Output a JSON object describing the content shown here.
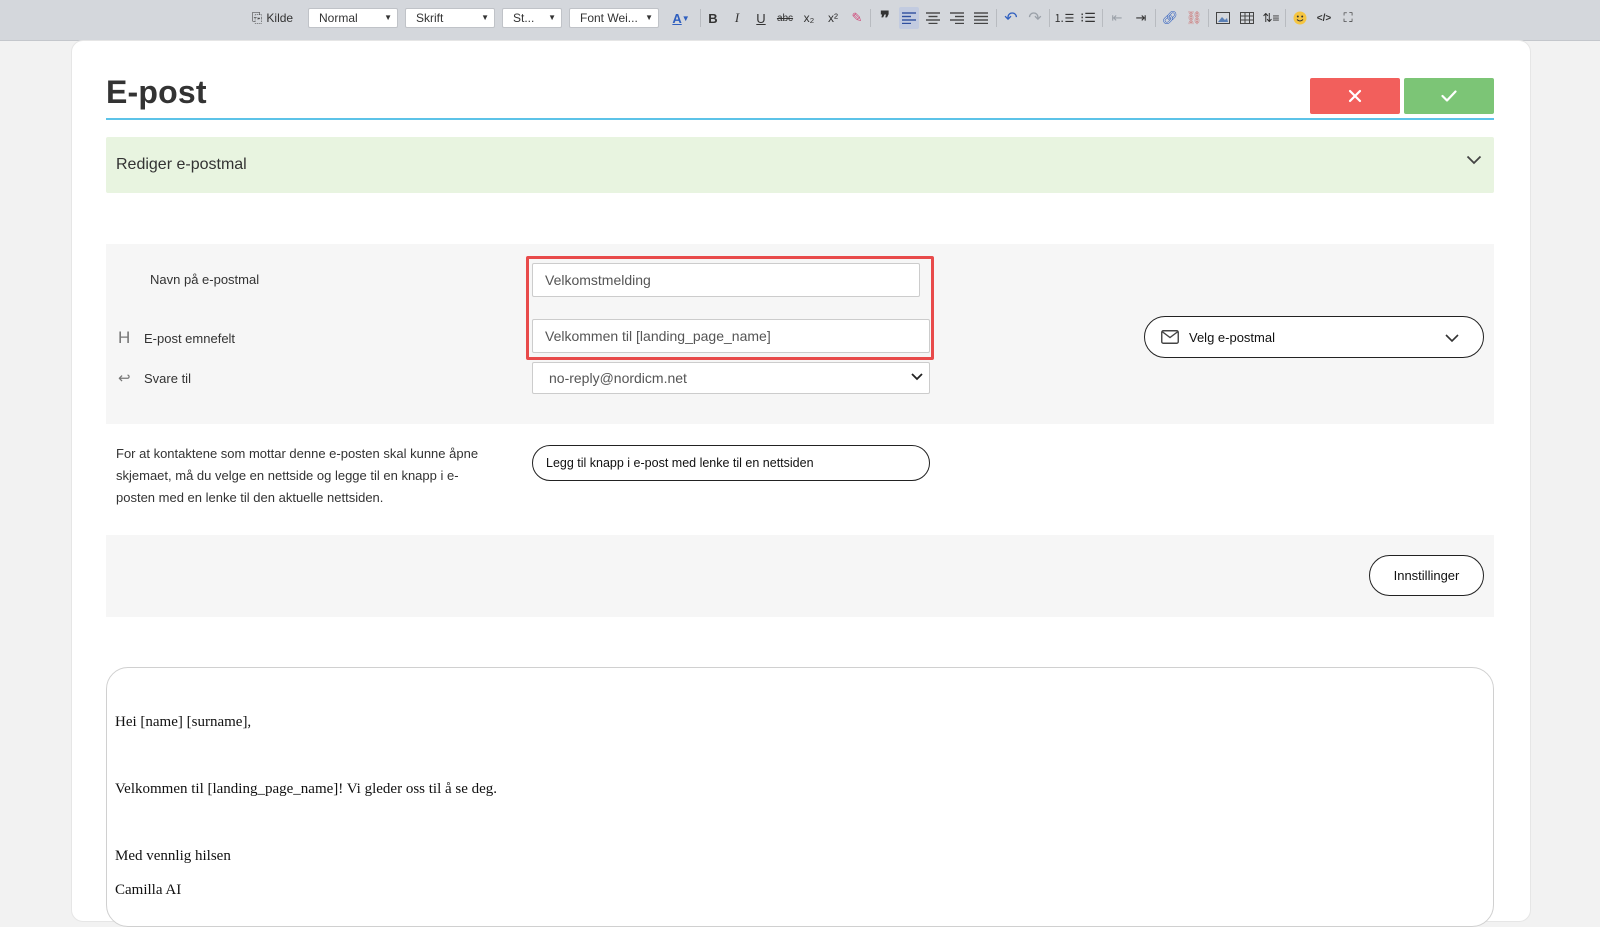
{
  "toolbar": {
    "source_label": "Kilde",
    "format_select": "Normal",
    "font_select": "Skrift",
    "size_select": "St...",
    "weight_select": "Font Wei..."
  },
  "header": {
    "title": "E-post"
  },
  "accordion": {
    "label": "Rediger e-postmal"
  },
  "form": {
    "template_name_label": "Navn på e-postmal",
    "template_name_value": "Velkomstmelding",
    "subject_label": "E-post emnefelt",
    "subject_value": "Velkommen til [landing_page_name]",
    "reply_to_label": "Svare til",
    "reply_to_value": "no-reply@nordicm.net",
    "choose_template_label": "Velg e-postmal"
  },
  "button_section": {
    "helper_text": "For at kontaktene som mottar denne e-posten skal kunne åpne skjemaet, må du velge en nettside og legge til en knapp i e-posten med en lenke til den aktuelle nettsiden.",
    "add_button_label": "Legg til knapp i e-post med lenke til en nettsiden"
  },
  "settings": {
    "button_label": "Innstillinger"
  },
  "editor": {
    "lines": [
      "Hei [name] [surname],",
      "Velkommen til [landing_page_name]! Vi gleder oss til å se deg.",
      "Med vennlig hilsen",
      "Camilla AI"
    ]
  },
  "colors": {
    "cancel": "#f25f5c",
    "save": "#7cc576",
    "accent_rule": "#5cc3e8",
    "accordion_bg": "#e8f4e0",
    "highlight": "#e84a4a"
  }
}
